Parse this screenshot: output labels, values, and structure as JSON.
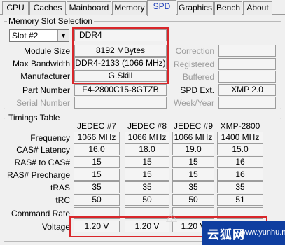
{
  "tabs": [
    "CPU",
    "Caches",
    "Mainboard",
    "Memory",
    "SPD",
    "Graphics",
    "Bench",
    "About"
  ],
  "active_tab": "SPD",
  "slot_section": {
    "title": "Memory Slot Selection",
    "slot_selected": "Slot #2",
    "memory_type": "DDR4",
    "module_size_label": "Module Size",
    "module_size": "8192 MBytes",
    "max_bandwidth_label": "Max Bandwidth",
    "max_bandwidth": "DDR4-2133 (1066 MHz)",
    "manufacturer_label": "Manufacturer",
    "manufacturer": "G.Skill",
    "part_number_label": "Part Number",
    "part_number": "F4-2800C15-8GTZB",
    "serial_number_label": "Serial Number",
    "serial_number": "",
    "correction_label": "Correction",
    "registered_label": "Registered",
    "buffered_label": "Buffered",
    "spd_ext_label": "SPD Ext.",
    "spd_ext": "XMP 2.0",
    "week_year_label": "Week/Year"
  },
  "timings": {
    "title": "Timings Table",
    "columns": [
      "JEDEC #7",
      "JEDEC #8",
      "JEDEC #9",
      "XMP-2800"
    ],
    "rows": [
      {
        "label": "Frequency",
        "values": [
          "1066 MHz",
          "1066 MHz",
          "1066 MHz",
          "1400 MHz"
        ]
      },
      {
        "label": "CAS# Latency",
        "values": [
          "16.0",
          "18.0",
          "19.0",
          "15.0"
        ]
      },
      {
        "label": "RAS# to CAS#",
        "values": [
          "15",
          "15",
          "15",
          "16"
        ]
      },
      {
        "label": "RAS# Precharge",
        "values": [
          "15",
          "15",
          "15",
          "16"
        ]
      },
      {
        "label": "tRAS",
        "values": [
          "35",
          "35",
          "35",
          "35"
        ]
      },
      {
        "label": "tRC",
        "values": [
          "50",
          "50",
          "50",
          "51"
        ]
      },
      {
        "label": "Command Rate",
        "values": [
          "",
          "",
          "",
          ""
        ]
      },
      {
        "label": "Voltage",
        "values": [
          "1.20 V",
          "1.20 V",
          "1.20 V",
          "1.350 V"
        ]
      }
    ]
  },
  "watermark": {
    "logo": "云狐网",
    "url": "www.yunhu.net"
  },
  "colors": {
    "highlight": "#d9262a",
    "active_tab_text": "#1f3fb8",
    "watermark_bg": "#0f3ea0"
  }
}
